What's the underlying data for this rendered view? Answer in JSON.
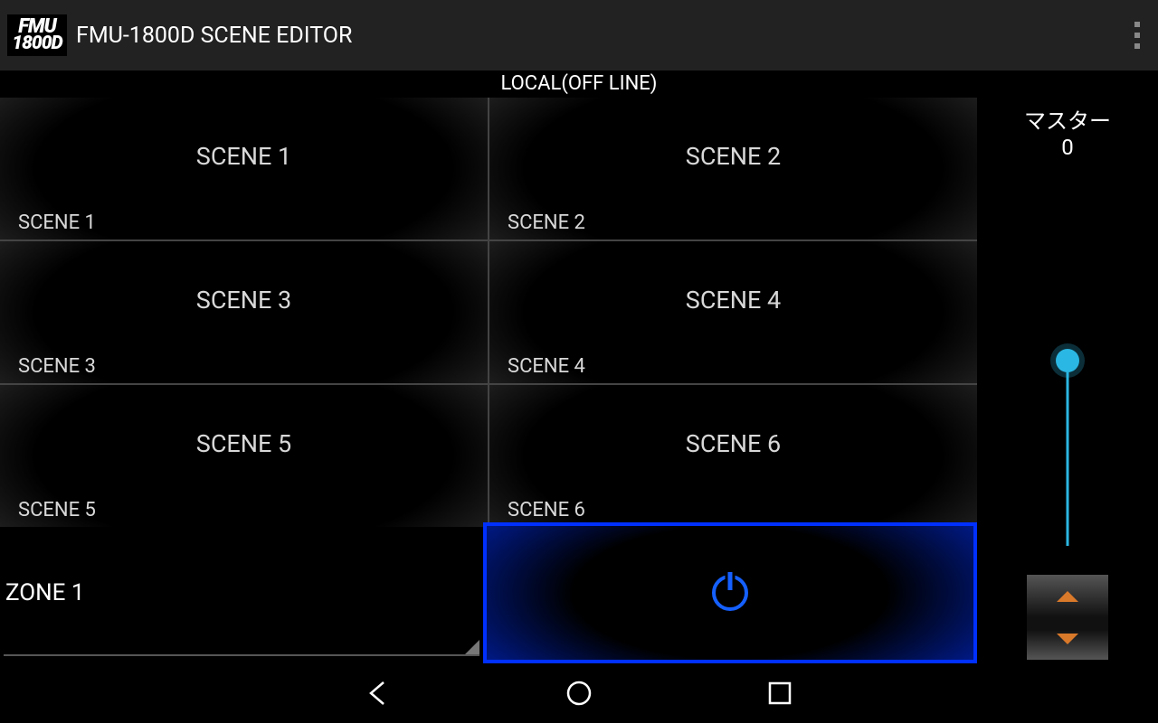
{
  "header": {
    "app_icon_text_1": "FMU",
    "app_icon_text_2": "1800D",
    "title": "FMU-1800D SCENE EDITOR"
  },
  "status": "LOCAL(OFF LINE)",
  "scenes": [
    {
      "title": "SCENE 1",
      "sub": "SCENE 1"
    },
    {
      "title": "SCENE 2",
      "sub": "SCENE 2"
    },
    {
      "title": "SCENE 3",
      "sub": "SCENE 3"
    },
    {
      "title": "SCENE 4",
      "sub": "SCENE 4"
    },
    {
      "title": "SCENE 5",
      "sub": "SCENE 5"
    },
    {
      "title": "SCENE 6",
      "sub": "SCENE 6"
    }
  ],
  "zone": {
    "selected": "ZONE 1"
  },
  "master": {
    "label": "マスター",
    "value": "0"
  }
}
